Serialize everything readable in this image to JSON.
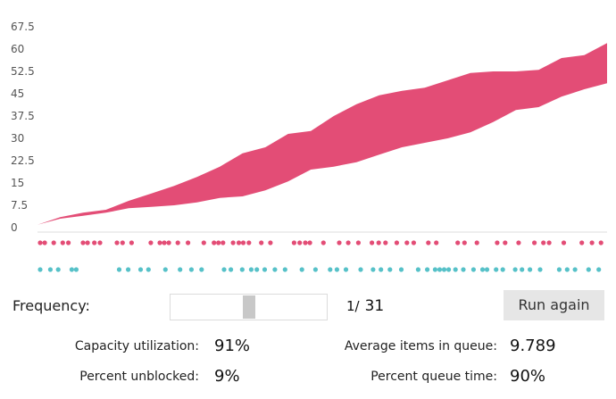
{
  "colors": {
    "area": "#e34d76",
    "dot_red": "#e34d76",
    "dot_teal": "#56c1c8",
    "axis": "#dddddd"
  },
  "chart_data": {
    "type": "area",
    "ylim": [
      0,
      67.5
    ],
    "y_ticks": [
      "0",
      "7.5",
      "15",
      "22.5",
      "30",
      "37.5",
      "45",
      "52.5",
      "60",
      "67.5"
    ],
    "x": [
      0,
      2,
      4,
      6,
      8,
      10,
      12,
      14,
      16,
      18,
      20,
      22,
      24,
      26,
      28,
      30,
      32,
      34,
      36,
      38,
      40,
      42,
      44,
      46,
      48,
      50
    ],
    "series": [
      {
        "values": [
          1,
          3.5,
          5,
          6,
          9,
          11.5,
          14,
          17,
          20.5,
          25,
          27,
          31.5,
          32.5,
          37.5,
          41.5,
          44.5,
          46,
          47,
          49.5,
          52,
          52.5,
          52.5,
          53,
          57,
          58,
          62
        ]
      },
      {
        "values": [
          1,
          3,
          4,
          5,
          6.5,
          7,
          7.5,
          8.5,
          10,
          10.5,
          12.5,
          15.5,
          19.5,
          20.5,
          22,
          24.5,
          27,
          28.5,
          30,
          32,
          35.5,
          39.5,
          40.5,
          44,
          46.5,
          48.5
        ]
      }
    ],
    "dots": {
      "red_rows": [
        [
          0,
          0.4,
          1.2,
          2.0,
          2.5,
          3.8,
          4.2,
          4.8,
          5.3,
          6.8,
          7.3,
          8.1,
          9.8,
          10.6,
          11.0,
          11.4,
          12.2,
          13.1,
          14.5,
          15.4,
          15.8,
          16.2,
          17.1,
          17.6,
          18.0,
          18.5,
          19.6,
          20.4,
          22.5,
          23.0,
          23.5,
          23.9,
          25.1,
          26.5,
          27.3,
          28.2,
          29.4,
          30.0,
          30.6,
          31.6,
          32.5,
          33.1,
          34.4,
          35.1,
          37.0,
          37.6,
          38.7,
          40.5,
          41.2,
          42.4,
          43.8,
          44.6,
          45.1,
          46.4,
          48.0,
          48.9,
          49.7
        ]
      ],
      "teal_rows": [
        [
          0,
          0.9,
          1.6,
          2.8,
          3.2,
          7.0,
          7.8,
          8.9,
          9.6,
          11.1,
          12.4,
          13.4,
          14.3,
          16.3,
          16.9,
          17.9,
          18.7,
          19.2,
          19.9,
          20.8,
          21.7,
          23.2,
          24.4,
          25.7,
          26.3,
          27.1,
          28.4,
          29.5,
          30.2,
          31.0,
          32.0,
          33.5,
          34.3,
          35.0,
          35.4,
          35.8,
          36.2,
          36.8,
          37.5,
          38.4,
          39.2,
          39.6,
          40.4,
          41.0,
          42.1,
          42.7,
          43.4,
          44.3,
          46.0,
          46.7,
          47.4,
          48.6,
          49.5
        ]
      ]
    }
  },
  "controls": {
    "frequency_label": "Frequency:",
    "frequency_value": "1/",
    "frequency_denominator": "31",
    "slider_value": 0.5,
    "run_button": "Run again"
  },
  "stats": {
    "capacity_label": "Capacity utilization:",
    "capacity_value": "91%",
    "unblocked_label": "Percent unblocked:",
    "unblocked_value": "9%",
    "avg_items_label": "Average items in queue:",
    "avg_items_value": "9.789",
    "queue_time_label": "Percent queue time:",
    "queue_time_value": "90%"
  }
}
